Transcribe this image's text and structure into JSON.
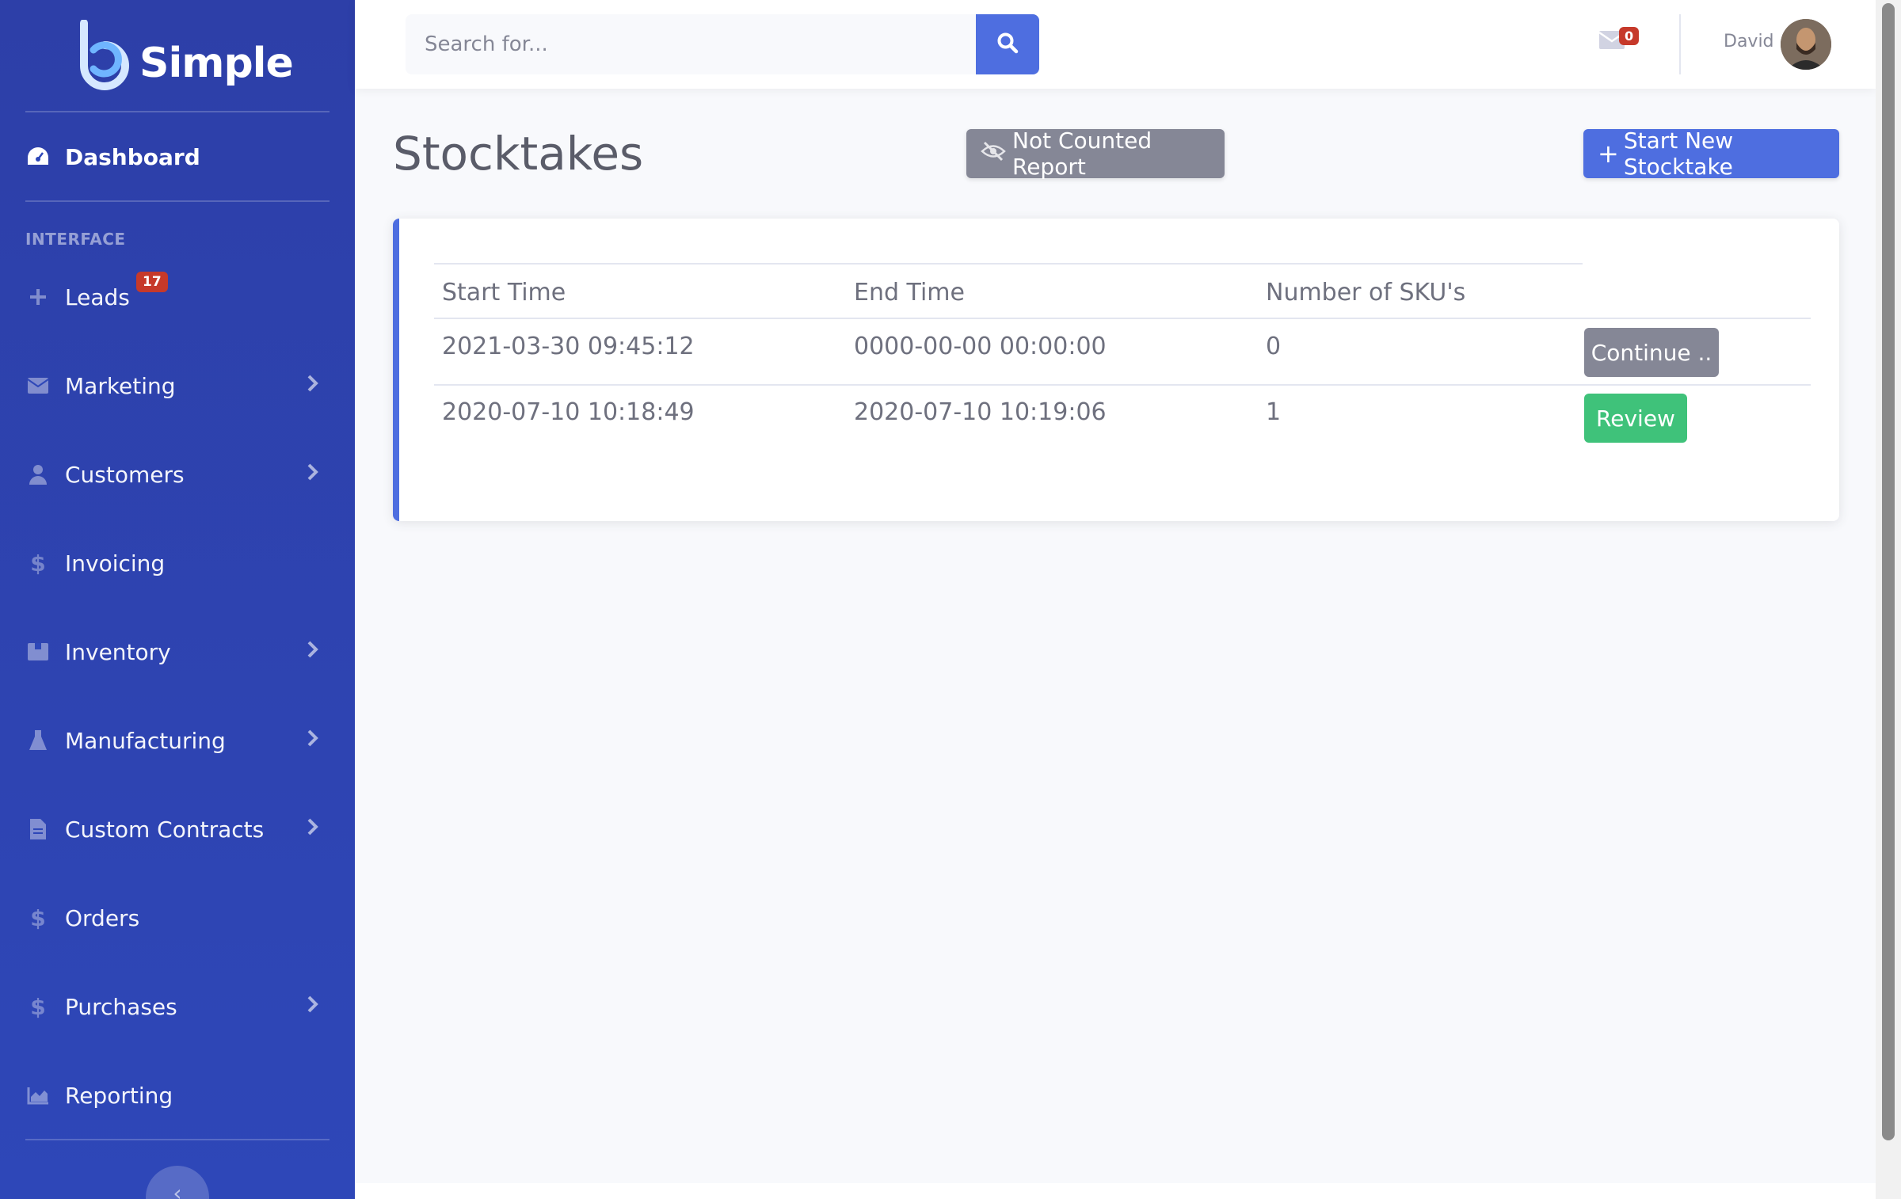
{
  "brand": {
    "name": "Simple"
  },
  "sidebar": {
    "dashboard_label": "Dashboard",
    "section_heading": "INTERFACE",
    "items": [
      {
        "label": "Leads",
        "badge": "17",
        "icon": "plus-icon"
      },
      {
        "label": "Marketing",
        "icon": "envelope-icon"
      },
      {
        "label": "Customers",
        "icon": "user-icon"
      },
      {
        "label": "Invoicing",
        "icon": "dollar-icon"
      },
      {
        "label": "Inventory",
        "icon": "box-icon"
      },
      {
        "label": "Manufacturing",
        "icon": "flask-icon"
      },
      {
        "label": "Custom Contracts",
        "icon": "document-icon"
      },
      {
        "label": "Orders",
        "icon": "dollar-icon"
      },
      {
        "label": "Purchases",
        "icon": "dollar-icon"
      },
      {
        "label": "Reporting",
        "icon": "area-chart-icon"
      }
    ],
    "toggle_glyph": "‹"
  },
  "topbar": {
    "search_placeholder": "Search for...",
    "messages_count": "0",
    "user_name": "David"
  },
  "page": {
    "title": "Stocktakes",
    "not_counted_label": "Not Counted Report",
    "start_new_label": "Start New Stocktake",
    "plus_glyph": "+"
  },
  "table": {
    "headers": [
      "Start Time",
      "End Time",
      "Number of SKU's"
    ],
    "rows": [
      {
        "start": "2021-03-30 09:45:12",
        "end": "0000-00-00 00:00:00",
        "skus": "0",
        "action": "Continue .."
      },
      {
        "start": "2020-07-10 10:18:49",
        "end": "2020-07-10 10:19:06",
        "skus": "1",
        "action": "Review"
      }
    ]
  },
  "colors": {
    "sidebar": "#2e47b8",
    "primary": "#4e6ee0",
    "secondary": "#858796",
    "success": "#3fc27a",
    "danger": "#c6392a"
  }
}
